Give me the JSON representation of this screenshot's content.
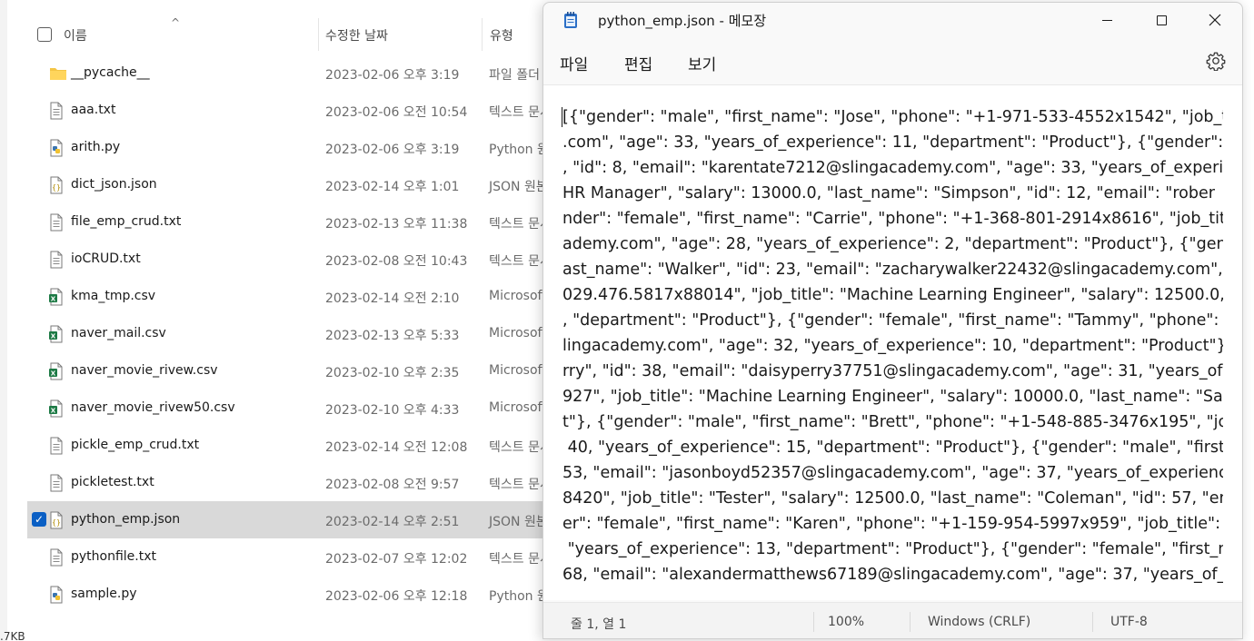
{
  "explorer": {
    "columns": {
      "name": "이름",
      "date": "수정한 날짜",
      "type": "유형"
    },
    "files": [
      {
        "name": "__pycache__",
        "date": "2023-02-06 오후 3:19",
        "type": "파일 폴더",
        "icon": "folder-icon"
      },
      {
        "name": "aaa.txt",
        "date": "2023-02-06 오전 10:54",
        "type": "텍스트 문서",
        "icon": "text-file-icon"
      },
      {
        "name": "arith.py",
        "date": "2023-02-06 오후 3:19",
        "type": "Python 원본",
        "icon": "python-file-icon"
      },
      {
        "name": "dict_json.json",
        "date": "2023-02-14 오후 1:01",
        "type": "JSON 원본",
        "icon": "json-file-icon"
      },
      {
        "name": "file_emp_crud.txt",
        "date": "2023-02-13 오후 11:38",
        "type": "텍스트 문서",
        "icon": "text-file-icon"
      },
      {
        "name": "ioCRUD.txt",
        "date": "2023-02-08 오전 10:43",
        "type": "텍스트 문서",
        "icon": "text-file-icon"
      },
      {
        "name": "kma_tmp.csv",
        "date": "2023-02-14 오전 2:10",
        "type": "Microsoft",
        "icon": "excel-file-icon"
      },
      {
        "name": "naver_mail.csv",
        "date": "2023-02-13 오후 5:33",
        "type": "Microsoft",
        "icon": "excel-file-icon"
      },
      {
        "name": "naver_movie_rivew.csv",
        "date": "2023-02-10 오후 2:35",
        "type": "Microsoft",
        "icon": "excel-file-icon"
      },
      {
        "name": "naver_movie_rivew50.csv",
        "date": "2023-02-10 오후 4:33",
        "type": "Microsoft",
        "icon": "excel-file-icon"
      },
      {
        "name": "pickle_emp_crud.txt",
        "date": "2023-02-14 오전 12:08",
        "type": "텍스트 문서",
        "icon": "text-file-icon"
      },
      {
        "name": "pickletest.txt",
        "date": "2023-02-08 오전 9:57",
        "type": "텍스트 문서",
        "icon": "text-file-icon"
      },
      {
        "name": "python_emp.json",
        "date": "2023-02-14 오후 2:51",
        "type": "JSON 원본",
        "icon": "json-file-icon",
        "selected": true
      },
      {
        "name": "pythonfile.txt",
        "date": "2023-02-07 오후 12:02",
        "type": "텍스트 문서",
        "icon": "text-file-icon"
      },
      {
        "name": "sample.py",
        "date": "2023-02-06 오후 12:18",
        "type": "Python 원본",
        "icon": "python-file-icon"
      }
    ],
    "status": ".7KB"
  },
  "notepad": {
    "title": "python_emp.json - 메모장",
    "menu": {
      "file": "파일",
      "edit": "편집",
      "view": "보기"
    },
    "settings_icon": "gear-icon",
    "content_lines": [
      "[{\"gender\": \"male\", \"first_name\": \"Jose\", \"phone\": \"+1-971-533-4552x1542\", \"job_t",
      ".com\", \"age\": 33, \"years_of_experience\": 11, \"department\": \"Product\"}, {\"gender\": \"",
      ", \"id\": 8, \"email\": \"karentate7212@slingacademy.com\", \"age\": 33, \"years_of_experie",
      "HR Manager\", \"salary\": 13000.0, \"last_name\": \"Simpson\", \"id\": 12, \"email\": \"rober",
      "nder\": \"female\", \"first_name\": \"Carrie\", \"phone\": \"+1-368-801-2914x8616\", \"job_tit",
      "ademy.com\", \"age\": 28, \"years_of_experience\": 2, \"department\": \"Product\"}, {\"gend",
      "ast_name\": \"Walker\", \"id\": 23, \"email\": \"zacharywalker22432@slingacademy.com\",",
      "029.476.5817x88014\", \"job_title\": \"Machine Learning Engineer\", \"salary\": 12500.0,",
      ", \"department\": \"Product\"}, {\"gender\": \"female\", \"first_name\": \"Tammy\", \"phone\": \"",
      "lingacademy.com\", \"age\": 32, \"years_of_experience\": 10, \"department\": \"Product\"}",
      "rry\", \"id\": 38, \"email\": \"daisyperry37751@slingacademy.com\", \"age\": 31, \"years_of",
      "927\", \"job_title\": \"Machine Learning Engineer\", \"salary\": 10000.0, \"last_name\": \"Sal",
      "t\"}, {\"gender\": \"male\", \"first_name\": \"Brett\", \"phone\": \"+1-548-885-3476x195\", \"job",
      " 40, \"years_of_experience\": 15, \"department\": \"Product\"}, {\"gender\": \"male\", \"first_",
      "53, \"email\": \"jasonboyd52357@slingacademy.com\", \"age\": 37, \"years_of_experienc",
      "8420\", \"job_title\": \"Tester\", \"salary\": 12500.0, \"last_name\": \"Coleman\", \"id\": 57, \"en",
      "er\": \"female\", \"first_name\": \"Karen\", \"phone\": \"+1-159-954-5997x959\", \"job_title\":",
      " \"years_of_experience\": 13, \"department\": \"Product\"}, {\"gender\": \"female\", \"first_na",
      "68, \"email\": \"alexandermatthews67189@slingacademy.com\", \"age\": 37, \"years_of_"
    ],
    "status": {
      "position": "줄 1, 열 1",
      "zoom": "100%",
      "eol": "Windows (CRLF)",
      "encoding": "UTF-8"
    }
  }
}
